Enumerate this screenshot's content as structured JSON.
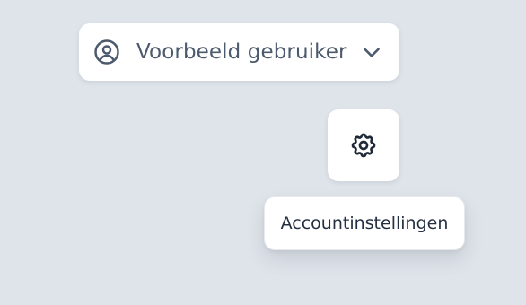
{
  "user_menu": {
    "label": "Voorbeeld gebruiker",
    "icon": "user-circle-icon",
    "chevron_icon": "chevron-down-icon"
  },
  "settings_button": {
    "icon": "gear-icon"
  },
  "tooltip": {
    "text": "Accountinstellingen"
  },
  "colors": {
    "background": "#dfe4ea",
    "surface": "#ffffff",
    "label_text": "#4b5a6d",
    "icon": "#4b5a6d",
    "gear": "#1f2937",
    "tooltip_text": "#243041"
  }
}
